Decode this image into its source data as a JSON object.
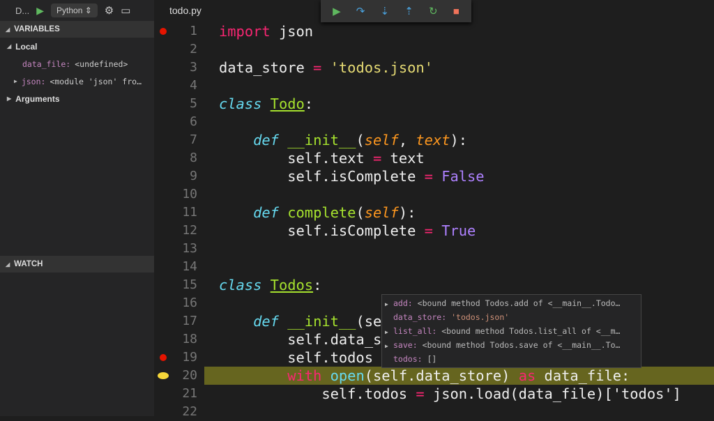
{
  "sidebar": {
    "debug_label": "D...",
    "config": "Python ⇕",
    "variables_title": "VARIABLES",
    "local_label": "Local",
    "locals": [
      {
        "name": "data_file",
        "value": "<undefined>",
        "expandable": false
      },
      {
        "name": "json",
        "value": "<module 'json' fro…",
        "expandable": true
      }
    ],
    "arguments_label": "Arguments",
    "watch_title": "WATCH"
  },
  "editor": {
    "tab": "todo.py",
    "current_line": 20,
    "breakpoints": [
      1,
      19
    ],
    "lines": [
      [
        [
          "import",
          "kw"
        ],
        [
          " json",
          "tx"
        ]
      ],
      [],
      [
        [
          "data_store ",
          "tx"
        ],
        [
          "=",
          "kw"
        ],
        [
          " ",
          "tx"
        ],
        [
          "'todos.json'",
          "st"
        ]
      ],
      [],
      [
        [
          "class",
          "sk"
        ],
        [
          " ",
          "tx"
        ],
        [
          "Todo",
          "cn"
        ],
        [
          ":",
          "tx"
        ]
      ],
      [],
      [
        [
          "    ",
          "tx"
        ],
        [
          "def",
          "sk"
        ],
        [
          " ",
          "tx"
        ],
        [
          "__init__",
          "fn"
        ],
        [
          "(",
          "tx"
        ],
        [
          "self",
          "pa"
        ],
        [
          ", ",
          "tx"
        ],
        [
          "text",
          "pa"
        ],
        [
          "):",
          "tx"
        ]
      ],
      [
        [
          "        self.text ",
          "tx"
        ],
        [
          "=",
          "kw"
        ],
        [
          " text",
          "tx"
        ]
      ],
      [
        [
          "        self.isComplete ",
          "tx"
        ],
        [
          "=",
          "kw"
        ],
        [
          " ",
          "tx"
        ],
        [
          "False",
          "cs"
        ]
      ],
      [],
      [
        [
          "    ",
          "tx"
        ],
        [
          "def",
          "sk"
        ],
        [
          " ",
          "tx"
        ],
        [
          "complete",
          "fn"
        ],
        [
          "(",
          "tx"
        ],
        [
          "self",
          "pa"
        ],
        [
          "):",
          "tx"
        ]
      ],
      [
        [
          "        self.isComplete ",
          "tx"
        ],
        [
          "=",
          "kw"
        ],
        [
          " ",
          "tx"
        ],
        [
          "True",
          "cs"
        ]
      ],
      [],
      [],
      [
        [
          "class",
          "sk"
        ],
        [
          " ",
          "tx"
        ],
        [
          "Todos",
          "cn"
        ],
        [
          ":",
          "tx"
        ]
      ],
      [],
      [
        [
          "    ",
          "tx"
        ],
        [
          "def",
          "sk"
        ],
        [
          " ",
          "tx"
        ],
        [
          "__init__",
          "fn"
        ],
        [
          "(se",
          "tx"
        ]
      ],
      [
        [
          "        self.data_s",
          "tx"
        ]
      ],
      [
        [
          "        self.todos",
          "tx"
        ]
      ],
      [
        [
          "        ",
          "tx"
        ],
        [
          "with",
          "kw"
        ],
        [
          " ",
          "tx"
        ],
        [
          "open",
          "bi"
        ],
        [
          "(self.data_store) ",
          "tx"
        ],
        [
          "as",
          "kw"
        ],
        [
          " data_file:",
          "tx"
        ]
      ],
      [
        [
          "            self.todos ",
          "tx"
        ],
        [
          "=",
          "kw"
        ],
        [
          " json.load(data_file)['todos']",
          "tx"
        ]
      ],
      []
    ]
  },
  "hover": {
    "rows": [
      {
        "name": "add",
        "value": "<bound method Todos.add of <__main__.Todo…",
        "expandable": true
      },
      {
        "name": "data_store",
        "value": "'todos.json'",
        "expandable": false,
        "string": true
      },
      {
        "name": "list_all",
        "value": "<bound method Todos.list_all of <__m…",
        "expandable": true
      },
      {
        "name": "save",
        "value": "<bound method Todos.save of <__main__.To…",
        "expandable": true
      },
      {
        "name": "todos",
        "value": "[]",
        "expandable": false
      }
    ]
  },
  "colors": {
    "continue": "#5fb85f",
    "step": "#4aa3df",
    "restart": "#5fb85f",
    "stop": "#f0735a",
    "breakpoint": "#e51400",
    "current": "#f5d63a",
    "highlight": "#66651f"
  }
}
